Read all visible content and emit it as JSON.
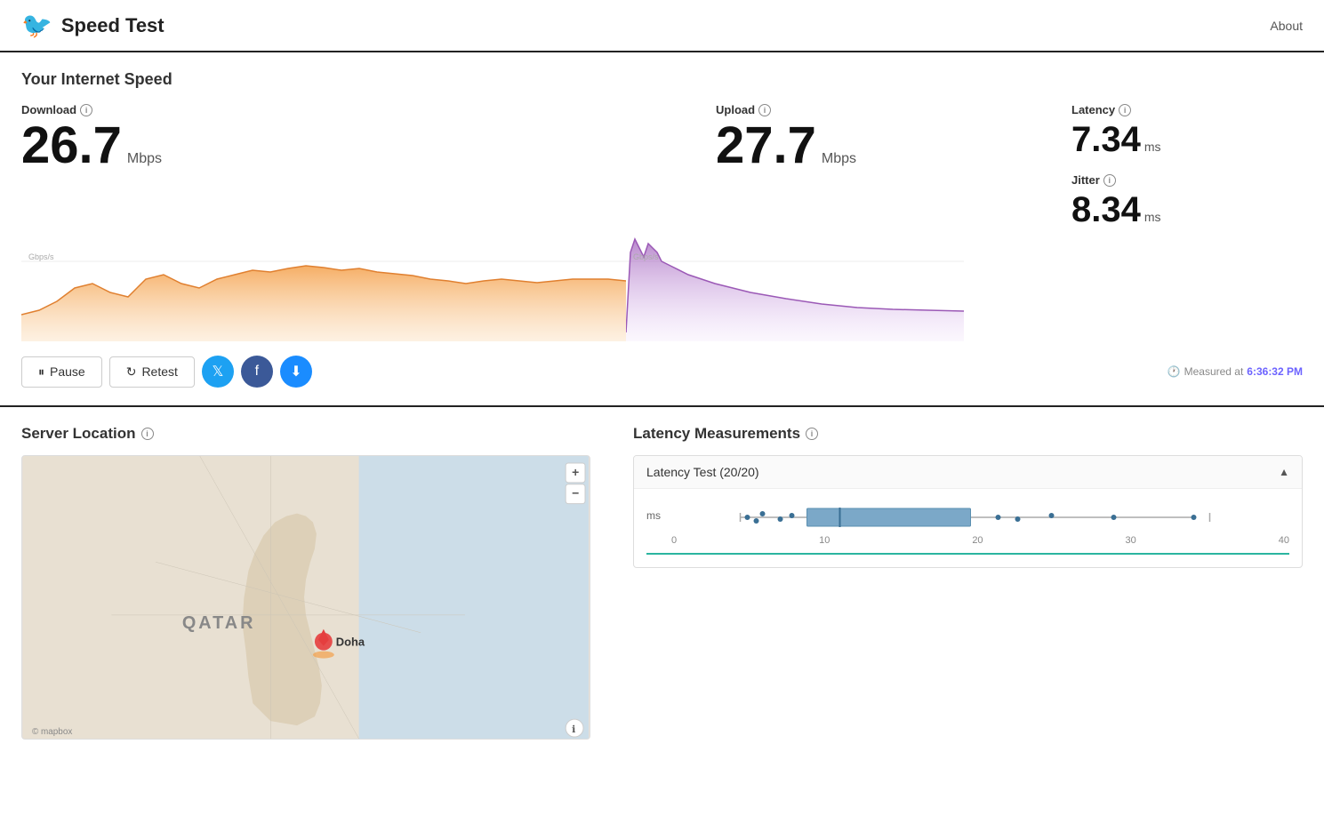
{
  "header": {
    "logo": "🐦",
    "title": "Speed Test",
    "about_label": "About"
  },
  "speed_section": {
    "title": "Your Internet Speed",
    "download": {
      "label": "Download",
      "value": "26.7",
      "unit": "Mbps"
    },
    "upload": {
      "label": "Upload",
      "value": "27.7",
      "unit": "Mbps"
    },
    "latency": {
      "label": "Latency",
      "value": "7.34",
      "unit": "ms"
    },
    "jitter": {
      "label": "Jitter",
      "value": "8.34",
      "unit": "ms"
    }
  },
  "controls": {
    "pause_label": "Pause",
    "retest_label": "Retest",
    "measured_label": "Measured at",
    "measured_time": "6:36:32 PM"
  },
  "server_section": {
    "title": "Server Location",
    "location": "Doha",
    "country": "QATAR"
  },
  "latency_measurements": {
    "title": "Latency Measurements",
    "panel_title": "Latency Test (20/20)",
    "axis_label": "ms",
    "axis_values": [
      "0",
      "10",
      "20",
      "30",
      "40"
    ]
  }
}
